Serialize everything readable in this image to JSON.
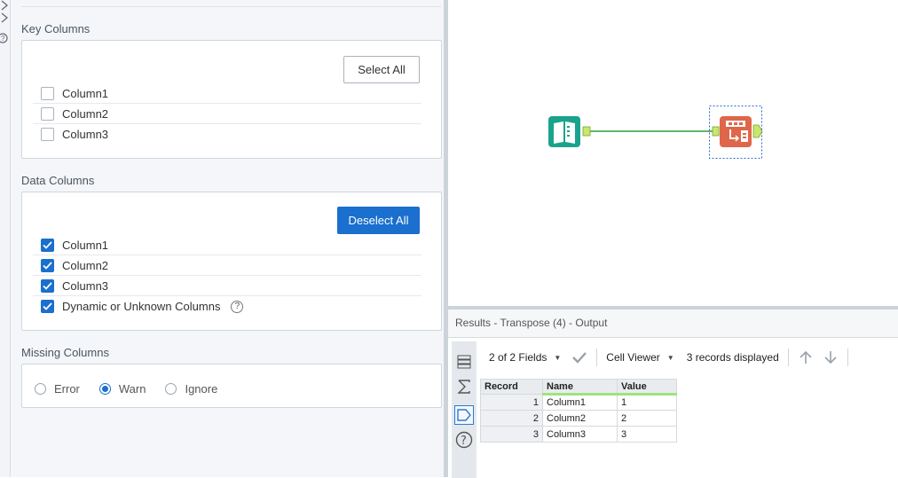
{
  "config": {
    "key_columns": {
      "title": "Key Columns",
      "button": "Select All",
      "items": [
        {
          "label": "Column1",
          "checked": false
        },
        {
          "label": "Column2",
          "checked": false
        },
        {
          "label": "Column3",
          "checked": false
        }
      ]
    },
    "data_columns": {
      "title": "Data Columns",
      "button": "Deselect All",
      "items": [
        {
          "label": "Column1",
          "checked": true
        },
        {
          "label": "Column2",
          "checked": true
        },
        {
          "label": "Column3",
          "checked": true
        },
        {
          "label": "Dynamic or Unknown Columns",
          "checked": true
        }
      ]
    },
    "missing_columns": {
      "title": "Missing Columns",
      "options": [
        "Error",
        "Warn",
        "Ignore"
      ],
      "selected": "Warn"
    }
  },
  "results": {
    "title": "Results - Transpose (4) - Output",
    "fields_dropdown": "2 of 2 Fields",
    "cell_viewer": "Cell Viewer",
    "records_displayed": "3 records displayed",
    "columns": [
      "Record",
      "Name",
      "Value"
    ],
    "rows": [
      [
        "1",
        "Column1",
        "1"
      ],
      [
        "2",
        "Column2",
        "2"
      ],
      [
        "3",
        "Column3",
        "3"
      ]
    ]
  },
  "colors": {
    "primary": "#1a6fcf",
    "input_tool": "#1aa38c",
    "transpose_tool": "#e0664a",
    "connector": "#2e9e3e"
  },
  "icons": {
    "input_tool": "book-icon",
    "transpose_tool": "transpose-icon",
    "check": "checkmark-icon",
    "help": "question-circle-icon"
  }
}
